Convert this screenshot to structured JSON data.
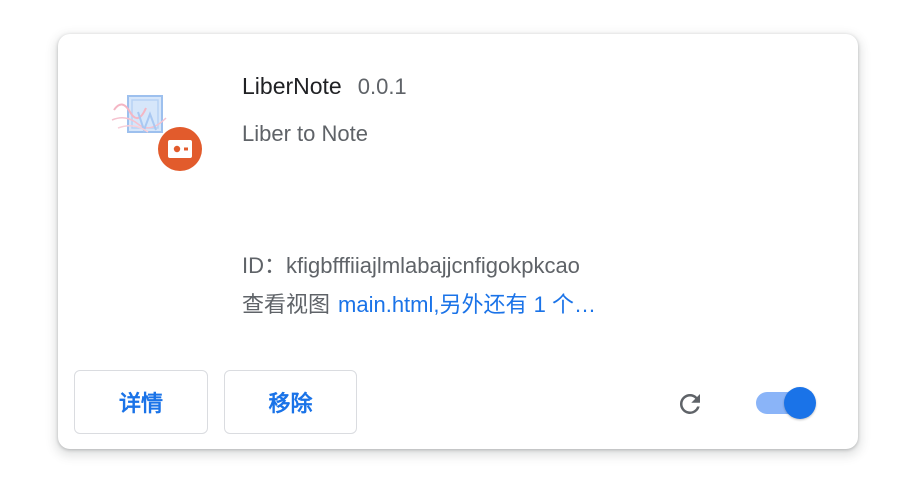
{
  "extension": {
    "name": "LiberNote",
    "version": "0.0.1",
    "description": "Liber to Note",
    "icon": "libernote-logo-icon",
    "badge_icon": "unpacked-extension-badge-icon",
    "id_label": "ID：",
    "id": "kfigbfffiiajlmlabajjcnfigokpkcao",
    "views_label": "查看视图",
    "views_link": "main.html,另外还有 1 个…"
  },
  "actions": {
    "details_label": "详情",
    "remove_label": "移除",
    "reload_icon": "reload-icon",
    "enabled": true
  },
  "colors": {
    "accent": "#1a73e8",
    "toggle_track": "#8ab4f8",
    "badge": "#e25b2c",
    "text_primary": "#202124",
    "text_secondary": "#5f6368"
  }
}
